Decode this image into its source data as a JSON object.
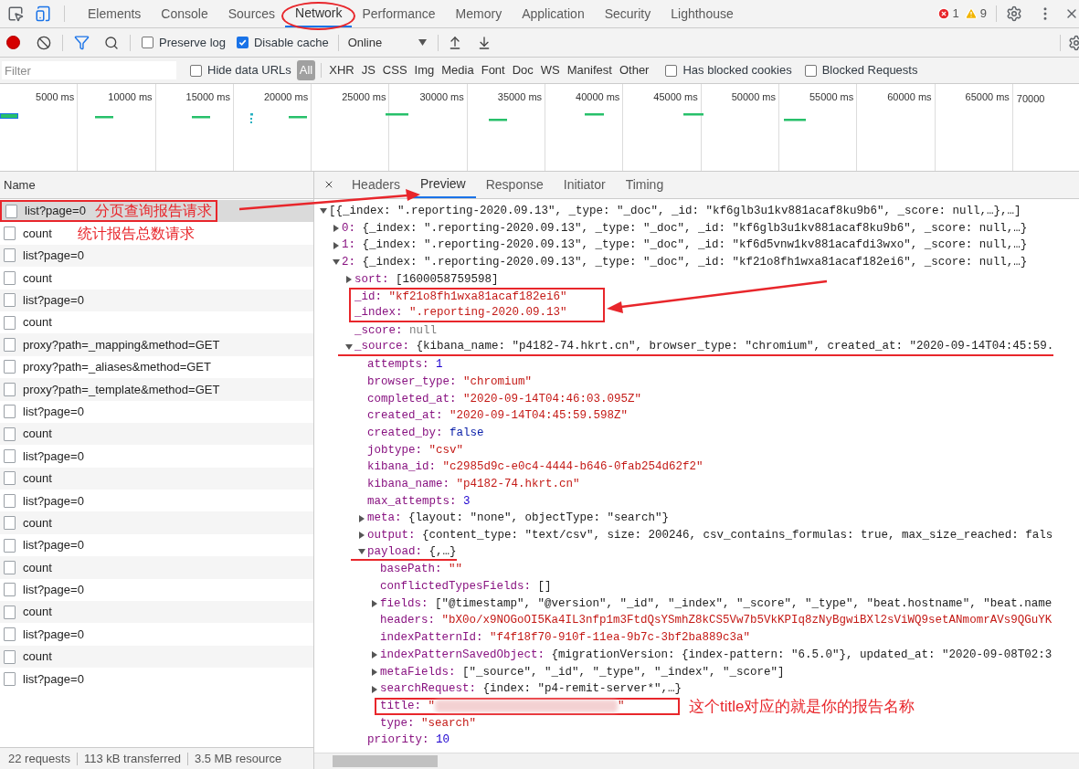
{
  "main_tabs": [
    {
      "label": "Elements",
      "selected": false,
      "circled": false
    },
    {
      "label": "Console",
      "selected": false,
      "circled": false
    },
    {
      "label": "Sources",
      "selected": false,
      "circled": false
    },
    {
      "label": "Network",
      "selected": true,
      "circled": true
    },
    {
      "label": "Performance",
      "selected": false,
      "circled": false
    },
    {
      "label": "Memory",
      "selected": false,
      "circled": false
    },
    {
      "label": "Application",
      "selected": false,
      "circled": false
    },
    {
      "label": "Security",
      "selected": false,
      "circled": false
    },
    {
      "label": "Lighthouse",
      "selected": false,
      "circled": false
    }
  ],
  "issues": {
    "errors": "1",
    "warnings": "9"
  },
  "toolbar": {
    "preserve_log": {
      "label": "Preserve log",
      "checked": false
    },
    "disable_cache": {
      "label": "Disable cache",
      "checked": true
    },
    "throttling": "Online"
  },
  "filter_bar": {
    "placeholder": "Filter",
    "hide_data_urls": {
      "label": "Hide data URLs",
      "checked": false
    },
    "types": [
      {
        "label": "All",
        "selected": true
      },
      {
        "label": "XHR",
        "selected": false
      },
      {
        "label": "JS",
        "selected": false
      },
      {
        "label": "CSS",
        "selected": false
      },
      {
        "label": "Img",
        "selected": false
      },
      {
        "label": "Media",
        "selected": false
      },
      {
        "label": "Font",
        "selected": false
      },
      {
        "label": "Doc",
        "selected": false
      },
      {
        "label": "WS",
        "selected": false
      },
      {
        "label": "Manifest",
        "selected": false
      },
      {
        "label": "Other",
        "selected": false
      }
    ],
    "has_blocked_cookies": {
      "label": "Has blocked cookies",
      "checked": false
    },
    "blocked_requests": {
      "label": "Blocked Requests",
      "checked": false
    }
  },
  "overview": {
    "ticks": [
      "5000 ms",
      "10000 ms",
      "15000 ms",
      "20000 ms",
      "25000 ms",
      "30000 ms",
      "35000 ms",
      "40000 ms",
      "45000 ms",
      "50000 ms",
      "55000 ms",
      "60000 ms",
      "65000 ms",
      "70000"
    ]
  },
  "requests": {
    "column": "Name",
    "rows": [
      {
        "name": "list?page=0",
        "selected": true,
        "boxed": true,
        "note": "分页查询报告请求"
      },
      {
        "name": "count",
        "selected": false,
        "boxed": false,
        "note": "统计报告总数请求"
      },
      {
        "name": "list?page=0",
        "selected": false,
        "boxed": false
      },
      {
        "name": "count",
        "selected": false,
        "boxed": false
      },
      {
        "name": "list?page=0",
        "selected": false,
        "boxed": false
      },
      {
        "name": "count",
        "selected": false,
        "boxed": false
      },
      {
        "name": "proxy?path=_mapping&method=GET",
        "selected": false,
        "boxed": false
      },
      {
        "name": "proxy?path=_aliases&method=GET",
        "selected": false,
        "boxed": false
      },
      {
        "name": "proxy?path=_template&method=GET",
        "selected": false,
        "boxed": false
      },
      {
        "name": "list?page=0",
        "selected": false,
        "boxed": false
      },
      {
        "name": "count",
        "selected": false,
        "boxed": false
      },
      {
        "name": "list?page=0",
        "selected": false,
        "boxed": false
      },
      {
        "name": "count",
        "selected": false,
        "boxed": false
      },
      {
        "name": "list?page=0",
        "selected": false,
        "boxed": false
      },
      {
        "name": "count",
        "selected": false,
        "boxed": false
      },
      {
        "name": "list?page=0",
        "selected": false,
        "boxed": false
      },
      {
        "name": "count",
        "selected": false,
        "boxed": false
      },
      {
        "name": "list?page=0",
        "selected": false,
        "boxed": false
      },
      {
        "name": "count",
        "selected": false,
        "boxed": false
      },
      {
        "name": "list?page=0",
        "selected": false,
        "boxed": false
      },
      {
        "name": "count",
        "selected": false,
        "boxed": false
      },
      {
        "name": "list?page=0",
        "selected": false,
        "boxed": false
      }
    ]
  },
  "status_bar": [
    "22 requests",
    "113 kB transferred",
    "3.5 MB resource"
  ],
  "detail_tabs": [
    {
      "label": "Headers",
      "selected": false
    },
    {
      "label": "Preview",
      "selected": true
    },
    {
      "label": "Response",
      "selected": false
    },
    {
      "label": "Initiator",
      "selected": false
    },
    {
      "label": "Timing",
      "selected": false
    }
  ],
  "preview": {
    "value": "[{_index: \".reporting-2020.09.13\", _type: \"_doc\", _id: \"kf6glb3u1kv881acaf8ku9b6\", _score: null,…},…]",
    "kind": "object",
    "expanded": true,
    "boxed": false,
    "underlined": false,
    "children": [
      {
        "key": "0:",
        "value": "{_index: \".reporting-2020.09.13\", _type: \"_doc\", _id: \"kf6glb3u1kv881acaf8ku9b6\", _score: null,…}",
        "kind": "object",
        "expanded": false,
        "boxed": false,
        "underlined": false
      },
      {
        "key": "1:",
        "value": "{_index: \".reporting-2020.09.13\", _type: \"_doc\", _id: \"kf6d5vnw1kv881acafdi3wxo\", _score: null,…}",
        "kind": "object",
        "expanded": false,
        "boxed": false,
        "underlined": false
      },
      {
        "key": "2:",
        "value": "{_index: \".reporting-2020.09.13\", _type: \"_doc\", _id: \"kf21o8fh1wxa81acaf182ei6\", _score: null,…}",
        "kind": "object",
        "expanded": true,
        "boxed": false,
        "underlined": false,
        "children": [
          {
            "key": "sort:",
            "value": "[1600058759598]",
            "kind": "object",
            "expanded": false,
            "boxed": false,
            "underlined": false
          },
          {
            "key": "_id:",
            "value": "\"kf21o8fh1wxa81acaf182ei6\"",
            "kind": "string",
            "boxed": true,
            "underlined": false
          },
          {
            "key": "_index:",
            "value": "\".reporting-2020.09.13\"",
            "kind": "string",
            "boxed": true,
            "underlined": false
          },
          {
            "key": "_score:",
            "value": "null",
            "kind": "null",
            "boxed": false,
            "underlined": false
          },
          {
            "key": "_source:",
            "value": "{kibana_name: \"p4182-74.hkrt.cn\", browser_type: \"chromium\", created_at: \"2020-09-14T04:45:59.",
            "kind": "object",
            "expanded": true,
            "boxed": false,
            "underlined": true,
            "children": [
              {
                "key": "attempts:",
                "value": "1",
                "kind": "number",
                "boxed": false,
                "underlined": false
              },
              {
                "key": "browser_type:",
                "value": "\"chromium\"",
                "kind": "string",
                "boxed": false,
                "underlined": false
              },
              {
                "key": "completed_at:",
                "value": "\"2020-09-14T04:46:03.095Z\"",
                "kind": "string",
                "boxed": false,
                "underlined": false
              },
              {
                "key": "created_at:",
                "value": "\"2020-09-14T04:45:59.598Z\"",
                "kind": "string",
                "boxed": false,
                "underlined": false
              },
              {
                "key": "created_by:",
                "value": "false",
                "kind": "bool",
                "boxed": false,
                "underlined": false
              },
              {
                "key": "jobtype:",
                "value": "\"csv\"",
                "kind": "string",
                "boxed": false,
                "underlined": false
              },
              {
                "key": "kibana_id:",
                "value": "\"c2985d9c-e0c4-4444-b646-0fab254d62f2\"",
                "kind": "string",
                "boxed": false,
                "underlined": false
              },
              {
                "key": "kibana_name:",
                "value": "\"p4182-74.hkrt.cn\"",
                "kind": "string",
                "boxed": false,
                "underlined": false
              },
              {
                "key": "max_attempts:",
                "value": "3",
                "kind": "number",
                "boxed": false,
                "underlined": false
              },
              {
                "key": "meta:",
                "value": "{layout: \"none\", objectType: \"search\"}",
                "kind": "object",
                "expanded": false,
                "boxed": false,
                "underlined": false
              },
              {
                "key": "output:",
                "value": "{content_type: \"text/csv\", size: 200246, csv_contains_formulas: true, max_size_reached: fals",
                "kind": "object",
                "expanded": false,
                "boxed": false,
                "underlined": false
              },
              {
                "key": "payload:",
                "value": "{,…}",
                "kind": "object",
                "expanded": true,
                "boxed": false,
                "underlined": true,
                "children": [
                  {
                    "key": "basePath:",
                    "value": "\"\"",
                    "kind": "string",
                    "boxed": false,
                    "underlined": false
                  },
                  {
                    "key": "conflictedTypesFields:",
                    "value": "[]",
                    "kind": "object",
                    "boxed": false,
                    "underlined": false
                  },
                  {
                    "key": "fields:",
                    "value": "[\"@timestamp\", \"@version\", \"_id\", \"_index\", \"_score\", \"_type\", \"beat.hostname\", \"beat.name",
                    "kind": "object",
                    "expanded": false,
                    "boxed": false,
                    "underlined": false
                  },
                  {
                    "key": "headers:",
                    "value": "\"bX0o/x9NOGoOI5Ka4IL3nfp1m3FtdQsYSmhZ8kCS5Vw7b5VkKPIq8zNyBgwiBXl2sViWQ9setANmomrAVs9QGuYK",
                    "kind": "string",
                    "boxed": false,
                    "underlined": false
                  },
                  {
                    "key": "indexPatternId:",
                    "value": "\"f4f18f70-910f-11ea-9b7c-3bf2ba889c3a\"",
                    "kind": "string",
                    "boxed": false,
                    "underlined": false
                  },
                  {
                    "key": "indexPatternSavedObject:",
                    "value": "{migrationVersion: {index-pattern: \"6.5.0\"}, updated_at: \"2020-09-08T02:3",
                    "kind": "object",
                    "expanded": false,
                    "boxed": false,
                    "underlined": false
                  },
                  {
                    "key": "metaFields:",
                    "value": "[\"_source\", \"_id\", \"_type\", \"_index\", \"_score\"]",
                    "kind": "object",
                    "expanded": false,
                    "boxed": false,
                    "underlined": false
                  },
                  {
                    "key": "searchRequest:",
                    "value": "{index: \"p4-remit-server*\",…}",
                    "kind": "object",
                    "expanded": false,
                    "boxed": false,
                    "underlined": false
                  },
                  {
                    "key": "title:",
                    "value": "\"",
                    "value_end": "\"",
                    "kind": "redacted",
                    "boxed": true,
                    "underlined": false,
                    "note": "这个title对应的就是你的报告名称"
                  },
                  {
                    "key": "type:",
                    "value": "\"search\"",
                    "kind": "string",
                    "boxed": false,
                    "underlined": false
                  }
                ]
              },
              {
                "key": "priority:",
                "value": "10",
                "kind": "number",
                "boxed": false,
                "underlined": false
              }
            ]
          }
        ]
      }
    ]
  }
}
